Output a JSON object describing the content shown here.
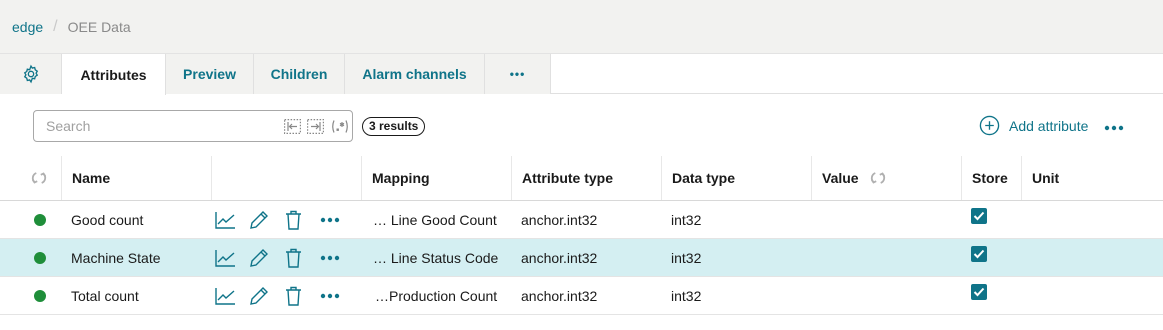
{
  "breadcrumb": {
    "root": "edge",
    "current": "OEE Data"
  },
  "tabs": [
    {
      "label": "Attributes"
    },
    {
      "label": "Preview"
    },
    {
      "label": "Children"
    },
    {
      "label": "Alarm channels"
    },
    {
      "label": "•••"
    }
  ],
  "toolbar": {
    "search_placeholder": "Search",
    "results": "3 results",
    "add_attribute": "Add attribute",
    "more": "•••"
  },
  "table": {
    "columns": {
      "name": "Name",
      "mapping": "Mapping",
      "attribute_type": "Attribute type",
      "data_type": "Data type",
      "value": "Value",
      "store": "Store",
      "unit": "Unit"
    },
    "rows": [
      {
        "status_color": "#1f8e3a",
        "name": "Good count",
        "mapping": "… Line Good Count",
        "attribute_type": "anchor.int32",
        "data_type": "int32",
        "value": "",
        "store": true,
        "unit": "",
        "selected": false
      },
      {
        "status_color": "#1f8e3a",
        "name": "Machine State",
        "mapping": "… Line Status Code",
        "attribute_type": "anchor.int32",
        "data_type": "int32",
        "value": "",
        "store": true,
        "unit": "",
        "selected": true
      },
      {
        "status_color": "#1f8e3a",
        "name": "Total count",
        "mapping": "…Production Count",
        "attribute_type": "anchor.int32",
        "data_type": "int32",
        "value": "",
        "store": true,
        "unit": "",
        "selected": false
      }
    ],
    "row_more": "•••"
  },
  "colors": {
    "accent": "#0f7489",
    "status_ok": "#1f8e3a",
    "selected_row": "#d4eff2"
  },
  "icons": [
    "gear-icon",
    "collapse-left-icon",
    "expand-right-icon",
    "regex-icon",
    "add-circle-icon",
    "refresh-icon",
    "chart-icon",
    "pencil-icon",
    "trash-icon",
    "checkbox-checked-icon"
  ]
}
